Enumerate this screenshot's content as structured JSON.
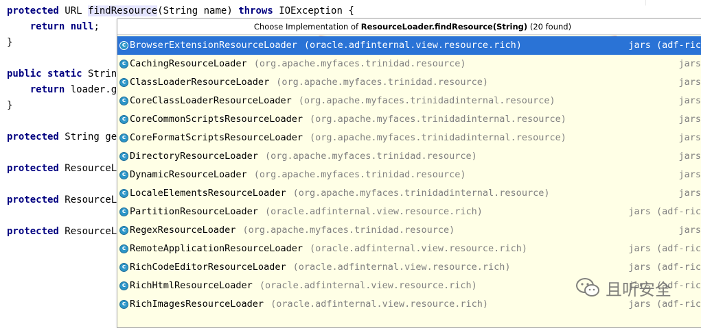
{
  "code": {
    "lines": [
      {
        "text_a": "protected",
        "text_b": " URL ",
        "text_c": "findResource",
        "text_d": "(String name) ",
        "text_e": "throws",
        "text_f": " IOException {"
      },
      {
        "text_a": "    return",
        "text_b": " ",
        "text_c": "null",
        "text_d": ";"
      },
      {
        "text": "}"
      },
      {
        "text_a": "public static",
        "text_b": " String"
      },
      {
        "text_a": "    return",
        "text_b": " loader.ge"
      },
      {
        "text": "}"
      },
      {
        "text_a": "protected",
        "text_b": " String get"
      },
      {
        "text_a": "protected",
        "text_b": " ResourceLo"
      },
      {
        "text_a": "protected",
        "text_b": " ResourceLo"
      },
      {
        "text_a": "protected",
        "text_b": " ResourceLo"
      }
    ]
  },
  "popup": {
    "title_prefix": "Choose Implementation of ",
    "title_method": "ResourceLoader.findResource(String)",
    "title_count": " (20 found)",
    "items": [
      {
        "name": "BrowserExtensionResourceLoader",
        "pkg": "(oracle.adfinternal.view.resource.rich)",
        "jars": "jars (adf-ric",
        "selected": true
      },
      {
        "name": "CachingResourceLoader",
        "pkg": "(org.apache.myfaces.trinidad.resource)",
        "jars": "jars"
      },
      {
        "name": "ClassLoaderResourceLoader",
        "pkg": "(org.apache.myfaces.trinidad.resource)",
        "jars": "jars"
      },
      {
        "name": "CoreClassLoaderResourceLoader",
        "pkg": "(org.apache.myfaces.trinidadinternal.resource)",
        "jars": "jars"
      },
      {
        "name": "CoreCommonScriptsResourceLoader",
        "pkg": "(org.apache.myfaces.trinidadinternal.resource)",
        "jars": "jars"
      },
      {
        "name": "CoreFormatScriptsResourceLoader",
        "pkg": "(org.apache.myfaces.trinidadinternal.resource)",
        "jars": "jars"
      },
      {
        "name": "DirectoryResourceLoader",
        "pkg": "(org.apache.myfaces.trinidad.resource)",
        "jars": "jars"
      },
      {
        "name": "DynamicResourceLoader",
        "pkg": "(org.apache.myfaces.trinidad.resource)",
        "jars": "jars"
      },
      {
        "name": "LocaleElementsResourceLoader",
        "pkg": "(org.apache.myfaces.trinidadinternal.resource)",
        "jars": "jars"
      },
      {
        "name": "PartitionResourceLoader",
        "pkg": "(oracle.adfinternal.view.resource.rich)",
        "jars": "jars (adf-ric"
      },
      {
        "name": "RegexResourceLoader",
        "pkg": "(org.apache.myfaces.trinidad.resource)",
        "jars": "jars"
      },
      {
        "name": "RemoteApplicationResourceLoader",
        "pkg": "(oracle.adfinternal.view.resource.rich)",
        "jars": "jars (adf-ric"
      },
      {
        "name": "RichCodeEditorResourceLoader",
        "pkg": "(oracle.adfinternal.view.resource.rich)",
        "jars": "jars (adf-ric"
      },
      {
        "name": "RichHtmlResourceLoader",
        "pkg": "(oracle.adfinternal.view.resource.rich)",
        "jars": "jars (adf-ric"
      },
      {
        "name": "RichImagesResourceLoader",
        "pkg": "(oracle.adfinternal.view.resource.rich)",
        "jars": "jars (adf-ric"
      }
    ]
  },
  "icons": {
    "class_icon": "class-icon",
    "class_letter": "c"
  },
  "watermark": {
    "text": "且听安全"
  },
  "colors": {
    "selection": "#2a73d6",
    "popup_bg": "#ffffe6",
    "keyword": "#000080",
    "annotation_red": "#e01010"
  }
}
